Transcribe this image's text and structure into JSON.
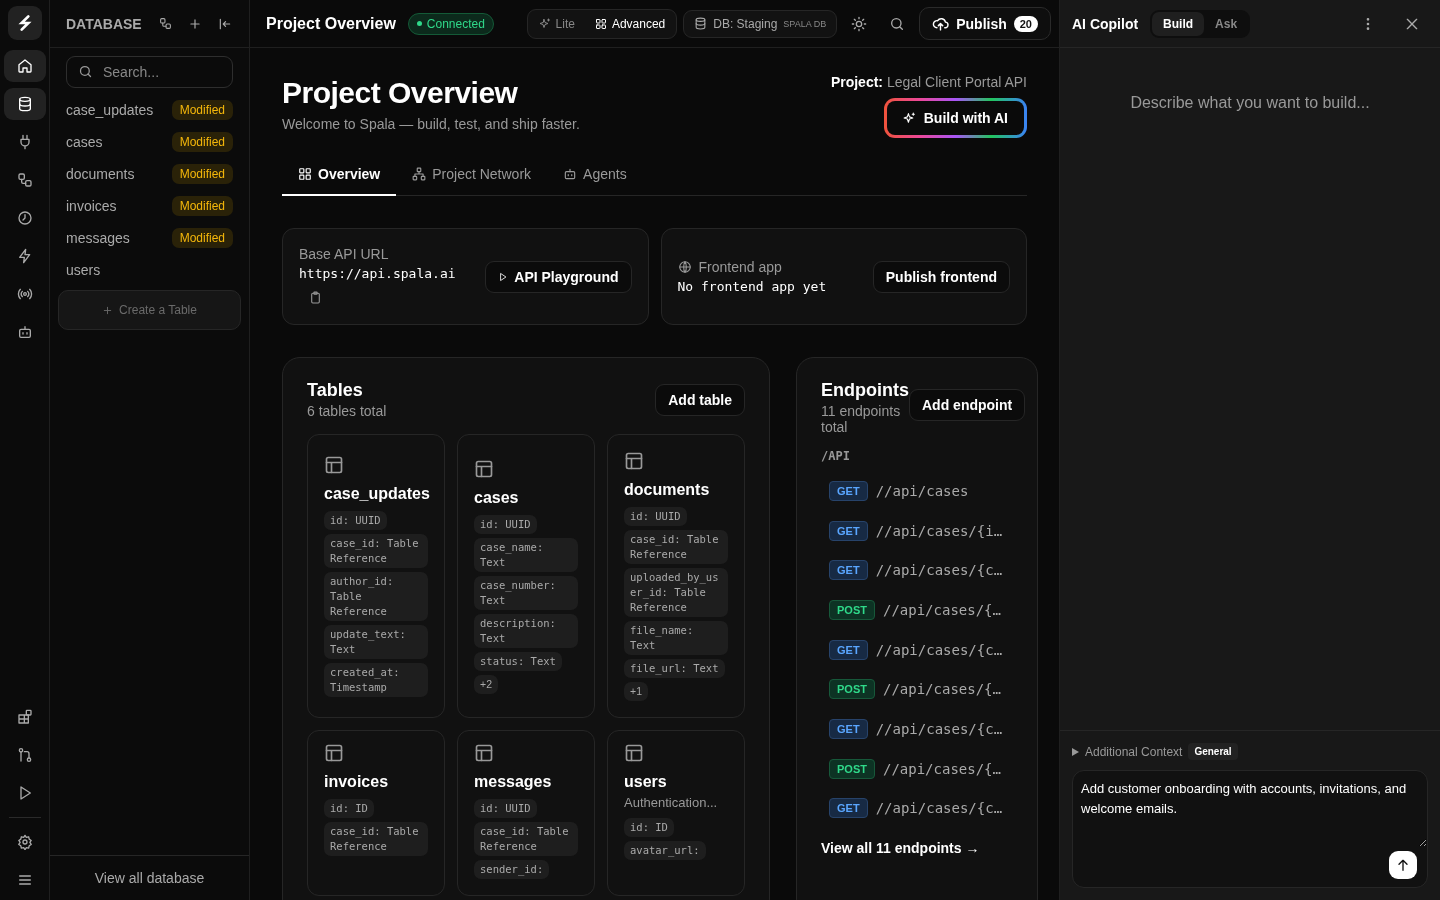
{
  "rail": {
    "top_items": [
      {
        "selected": true
      },
      {
        "selected": true
      },
      {
        "selected": false
      },
      {
        "selected": false
      },
      {
        "selected": false
      },
      {
        "selected": false
      },
      {
        "selected": false
      },
      {
        "selected": false
      }
    ],
    "bottom_items": [
      {
        "selected": false
      },
      {
        "selected": false
      },
      {
        "selected": false
      },
      {
        "selected": false
      },
      {
        "selected": false
      }
    ]
  },
  "sidebar": {
    "title": "DATABASE",
    "search": {
      "placeholder": "Search..."
    },
    "items": [
      {
        "name": "case_updates",
        "badge": "Modified"
      },
      {
        "name": "cases",
        "badge": "Modified"
      },
      {
        "name": "documents",
        "badge": "Modified"
      },
      {
        "name": "invoices",
        "badge": "Modified"
      },
      {
        "name": "messages",
        "badge": "Modified"
      },
      {
        "name": "users"
      }
    ],
    "create_button": "Create a Table",
    "footer_link": "View all database"
  },
  "header": {
    "title": "Project Overview",
    "status": "Connected",
    "modes": [
      {
        "label": "Lite",
        "selected": false
      },
      {
        "label": "Advanced",
        "selected": true
      }
    ],
    "db": {
      "label": "DB: Staging",
      "tag": "SPALA DB"
    },
    "publish": {
      "label": "Publish",
      "count": "20"
    }
  },
  "page": {
    "title": "Project Overview",
    "subtitle": "Welcome to Spala — build, test, and ship faster.",
    "project_label": "Project:",
    "project_name": "Legal Client Portal API",
    "build_button": "Build with AI",
    "tabs": [
      {
        "label": "Overview",
        "selected": true
      },
      {
        "label": "Project Network",
        "selected": false
      },
      {
        "label": "Agents",
        "selected": false
      }
    ],
    "api_card": {
      "label": "Base API URL",
      "url": "https://api.spala.ai",
      "button": "API Playground"
    },
    "frontend_card": {
      "label": "Frontend app",
      "value": "No frontend app yet",
      "button": "Publish frontend"
    },
    "tables": {
      "title": "Tables",
      "subtitle": "6 tables total",
      "button": "Add table",
      "items": [
        {
          "name": "case_updates",
          "fields": [
            "id: UUID",
            "case_id: Table Reference",
            "author_id: Table Reference",
            "update_text: Text",
            "created_at: Timestamp"
          ]
        },
        {
          "name": "cases",
          "fields": [
            "id: UUID",
            "case_name: Text",
            "case_number: Text",
            "description: Text",
            "status: Text"
          ],
          "more": "+2"
        },
        {
          "name": "documents",
          "fields": [
            "id: UUID",
            "case_id: Table Reference",
            "uploaded_by_user_id: Table Reference",
            "file_name: Text",
            "file_url: Text"
          ],
          "more": "+1"
        },
        {
          "name": "invoices",
          "fields": [
            "id: ID",
            "case_id: Table Reference"
          ]
        },
        {
          "name": "messages",
          "fields": [
            "id: UUID",
            "case_id: Table Reference",
            "sender_id:"
          ]
        },
        {
          "name": "users",
          "description": "Authentication...",
          "fields": [
            "id: ID",
            "avatar_url:"
          ]
        }
      ]
    },
    "endpoints": {
      "title": "Endpoints",
      "subtitle": "11 endpoints total",
      "button": "Add endpoint",
      "group": "/API",
      "items": [
        {
          "method": "GET",
          "path": "//api/cases"
        },
        {
          "method": "GET",
          "path": "//api/cases/{i…"
        },
        {
          "method": "GET",
          "path": "//api/cases/{c…"
        },
        {
          "method": "POST",
          "path": "//api/cases/{…"
        },
        {
          "method": "GET",
          "path": "//api/cases/{c…"
        },
        {
          "method": "POST",
          "path": "//api/cases/{…"
        },
        {
          "method": "GET",
          "path": "//api/cases/{c…"
        },
        {
          "method": "POST",
          "path": "//api/cases/{…"
        },
        {
          "method": "GET",
          "path": "//api/cases/{c…"
        }
      ],
      "footer_link": "View all 11 endpoints →"
    }
  },
  "copilot": {
    "title": "AI Copilot",
    "modes": [
      {
        "label": "Build",
        "selected": true
      },
      {
        "label": "Ask",
        "selected": false
      }
    ],
    "empty_text": "Describe what you want to build...",
    "context_label": "Additional Context",
    "context_tag": "General",
    "prompt": "Add customer onboarding with accounts, invitations, and welcome emails."
  }
}
